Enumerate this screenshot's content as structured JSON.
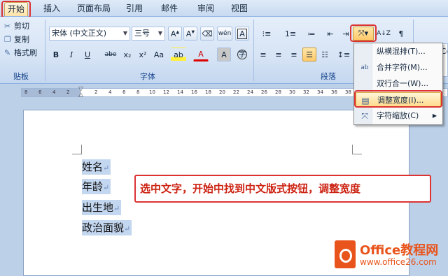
{
  "tabs": [
    "开始",
    "插入",
    "页面布局",
    "引用",
    "邮件",
    "审阅",
    "视图"
  ],
  "clipboard": {
    "items": [
      "剪切",
      "复制",
      "格式刷"
    ],
    "group_label": "贴板"
  },
  "font": {
    "family": "宋体 (中文正文)",
    "size": "三号",
    "group_label": "字体",
    "buttons": [
      "B",
      "I",
      "U",
      "abe",
      "x₂",
      "x²",
      "Aa",
      "A",
      "A"
    ]
  },
  "paragraph": {
    "group_label": "段落"
  },
  "styles": {
    "preview": "AaBbCc"
  },
  "ruler": {
    "numbers": [
      "8",
      "6",
      "4",
      "2",
      "2",
      "4",
      "6",
      "8",
      "10",
      "12",
      "14",
      "16",
      "18",
      "20",
      "22",
      "24",
      "26",
      "28",
      "30",
      "32",
      "34",
      "36",
      "38"
    ]
  },
  "document": {
    "lines": [
      "姓名",
      "年龄",
      "出生地",
      "政治面貌"
    ],
    "para_mark": "↵"
  },
  "callout": {
    "text": "选中文字，开始中找到中文版式按钮，调整宽度"
  },
  "menu": {
    "items": [
      {
        "label": "纵横混排(T)...",
        "icon": "vertical-mixed-icon"
      },
      {
        "label": "合并字符(M)...",
        "icon": "combine-chars-icon"
      },
      {
        "label": "双行合一(W)...",
        "icon": "two-lines-icon"
      },
      {
        "label": "调整宽度(I)...",
        "icon": "adjust-width-icon"
      },
      {
        "label": "字符缩放(C)",
        "icon": "char-scale-icon"
      }
    ]
  },
  "logo": {
    "title": "Office教程网",
    "url": "www.office26.com"
  },
  "colors": {
    "highlight_red": "#dd3333",
    "logo_orange": "#e8541b",
    "selection_blue": "#c4d7f0"
  }
}
